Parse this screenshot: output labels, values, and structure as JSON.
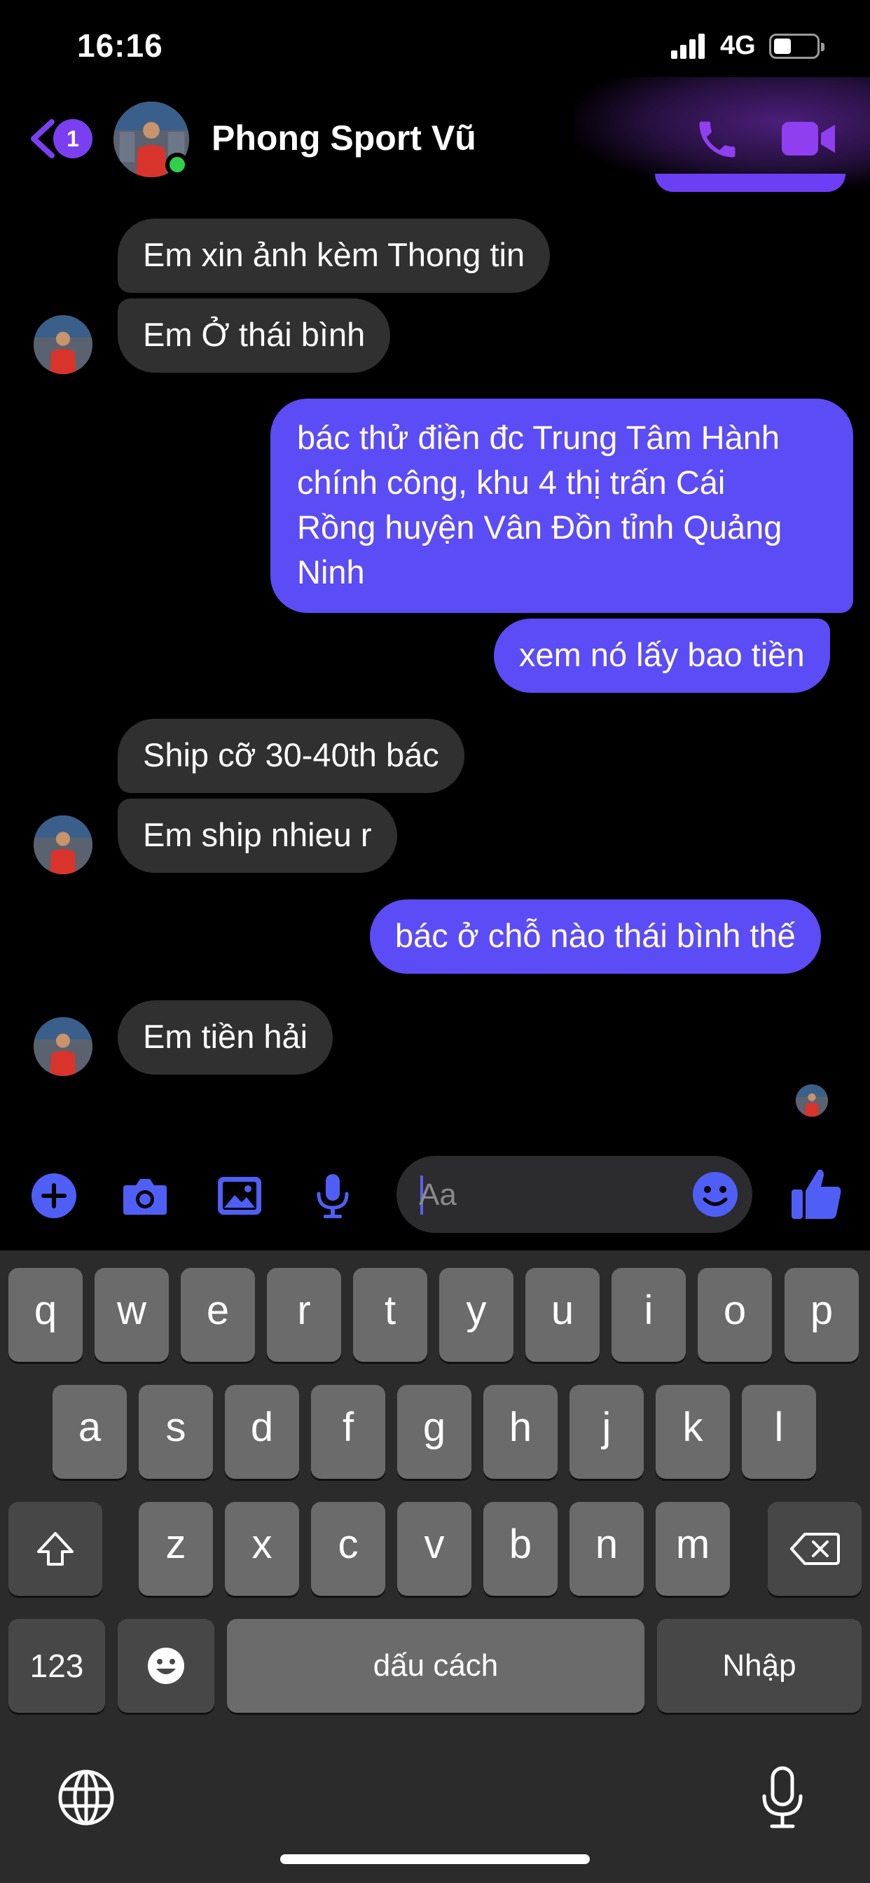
{
  "status_bar": {
    "time": "16:16",
    "network": "4G"
  },
  "header": {
    "unread_count": "1",
    "contact_name": "Phong Sport Vũ"
  },
  "messages": [
    {
      "side": "in",
      "text": "Em xin ảnh kèm Thong tin"
    },
    {
      "side": "in",
      "text": "Em Ở thái bình"
    },
    {
      "side": "out",
      "lines": [
        "bác thử điền đc Trung Tâm Hành",
        "chính công, khu 4 thị trấn Cái",
        "Rồng huyện Vân Đồn tỉnh Quảng",
        "Ninh"
      ]
    },
    {
      "side": "out",
      "text": "xem nó lấy bao tiền"
    },
    {
      "side": "in",
      "text": "Ship cỡ 30-40th bác"
    },
    {
      "side": "in",
      "text": "Em ship nhieu r"
    },
    {
      "side": "out",
      "text": "bác ở chỗ nào thái bình thế"
    },
    {
      "side": "in",
      "text": "Em tiền hải"
    }
  ],
  "composer": {
    "placeholder": "Aa"
  },
  "keyboard": {
    "row1": [
      "q",
      "w",
      "e",
      "r",
      "t",
      "y",
      "u",
      "i",
      "o",
      "p"
    ],
    "row2": [
      "a",
      "s",
      "d",
      "f",
      "g",
      "h",
      "j",
      "k",
      "l"
    ],
    "row3": [
      "z",
      "x",
      "c",
      "v",
      "b",
      "n",
      "m"
    ],
    "numbers_key": "123",
    "space_key": "dấu cách",
    "return_key": "Nhập"
  },
  "colors": {
    "accent": "#7b3ff2",
    "outgoing_bubble": "#5c4cf5",
    "incoming_bubble": "#303030",
    "online": "#31d04a"
  },
  "icons": [
    "back-chevron-icon",
    "phone-icon",
    "video-camera-icon",
    "plus-icon",
    "camera-icon",
    "image-icon",
    "microphone-icon",
    "emoji-icon",
    "thumbs-up-icon",
    "shift-icon",
    "backspace-icon",
    "globe-icon",
    "dictation-mic-icon"
  ]
}
